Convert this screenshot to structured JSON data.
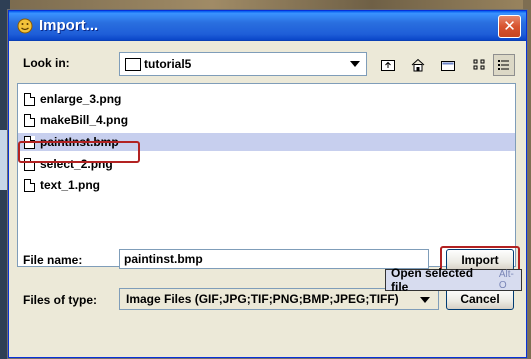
{
  "window": {
    "title": "Import...",
    "close_glyph": "✕"
  },
  "lookin": {
    "label": "Look in:",
    "value": "tutorial5"
  },
  "toolbar": {
    "up_one_level": "up-folder-icon",
    "home": "home-icon",
    "new_folder": "new-folder-icon",
    "list_view": "list-view-icon",
    "details_view": "details-view-icon"
  },
  "files": [
    {
      "name": "enlarge_3.png"
    },
    {
      "name": "makeBill_4.png"
    },
    {
      "name": "paintInst.bmp"
    },
    {
      "name": "select_2.png"
    },
    {
      "name": "text_1.png"
    }
  ],
  "selected_index": 2,
  "filename": {
    "label": "File name:",
    "value": "paintinst.bmp"
  },
  "filetype": {
    "label": "Files of type:",
    "value": "Image Files (GIF;JPG;TIF;PNG;BMP;JPEG;TIFF)"
  },
  "buttons": {
    "import": "Import",
    "cancel": "Cancel"
  },
  "tooltip": {
    "text": "Open selected file",
    "shortcut": "Alt-O"
  },
  "colors": {
    "titlebar": "#1e5ed8",
    "selection": "#c7cfee",
    "highlight_outline": "#b22222"
  }
}
